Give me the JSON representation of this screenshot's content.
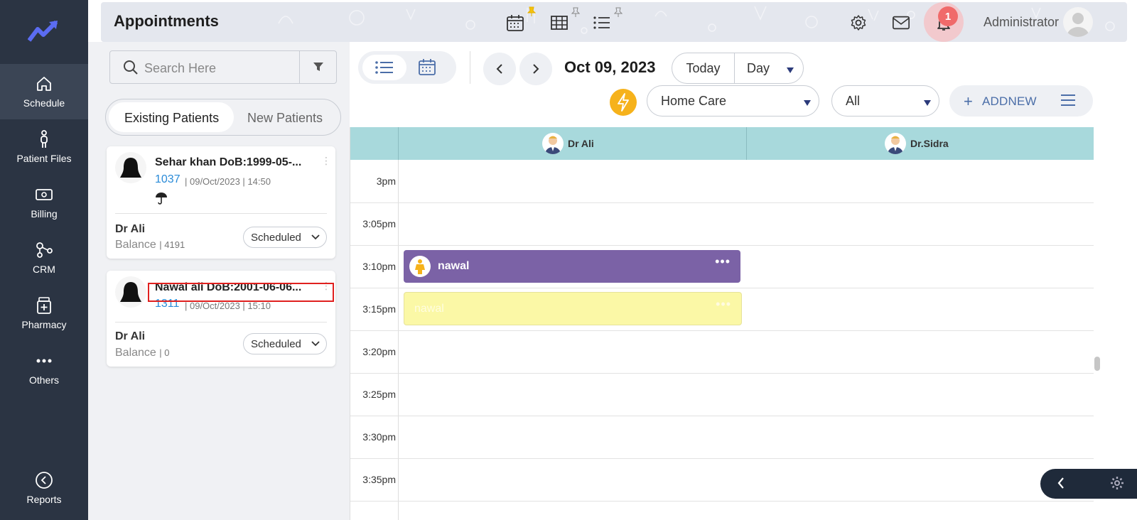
{
  "app": {
    "page_title": "Appointments",
    "admin_name": "Administrator",
    "notification_count": "1"
  },
  "nav": {
    "items": [
      {
        "label": "Schedule",
        "icon": "home-icon"
      },
      {
        "label": "Patient Files",
        "icon": "person-icon"
      },
      {
        "label": "Billing",
        "icon": "money-icon"
      },
      {
        "label": "CRM",
        "icon": "network-icon"
      },
      {
        "label": "Pharmacy",
        "icon": "pharmacy-icon"
      },
      {
        "label": "Others",
        "icon": "more-icon"
      },
      {
        "label": "Reports",
        "icon": "reports-icon"
      }
    ]
  },
  "patients": {
    "search_placeholder": "Search Here",
    "tabs": [
      "Existing Patients",
      "New Patients"
    ],
    "active_tab": "Existing Patients",
    "cards": [
      {
        "name": "Sehar khan DoB:1999-05-...",
        "id": "1037",
        "meta": "| 09/Oct/2023 | 14:50",
        "doctor": "Dr Ali",
        "balance_label": "Balance",
        "balance_value": "| 4191",
        "status": "Scheduled"
      },
      {
        "name": "Nawal ali DoB:2001-06-06...",
        "id": "1311",
        "meta": "| 09/Oct/2023 | 15:10",
        "doctor": "Dr Ali",
        "balance_label": "Balance",
        "balance_value": "| 0",
        "status": "Scheduled"
      }
    ]
  },
  "toolbar": {
    "date": "Oct 09, 2023",
    "today_label": "Today",
    "view_label": "Day",
    "clinic_select": "Home Care",
    "filter_select": "All",
    "addnew_label": "ADDNEW"
  },
  "calendar": {
    "resources": [
      "Dr Ali",
      "Dr.Sidra"
    ],
    "times": [
      "3pm",
      "3:05pm",
      "3:10pm",
      "3:15pm",
      "3:20pm",
      "3:25pm",
      "3:30pm",
      "3:35pm"
    ],
    "appointments": [
      {
        "name": "nawal",
        "resource": "Dr Ali",
        "time": "3:10pm",
        "color": "#7b62a6"
      },
      {
        "name": "nawal",
        "resource": "Dr Ali",
        "time": "3:15pm",
        "color": "#fbf8a6"
      }
    ]
  },
  "colors": {
    "nav_bg": "#2b3443",
    "accent_blue": "#2a8bd8",
    "calendar_header": "#a8d9dc",
    "flash": "#f6b21b",
    "notif": "#f06a6a"
  }
}
